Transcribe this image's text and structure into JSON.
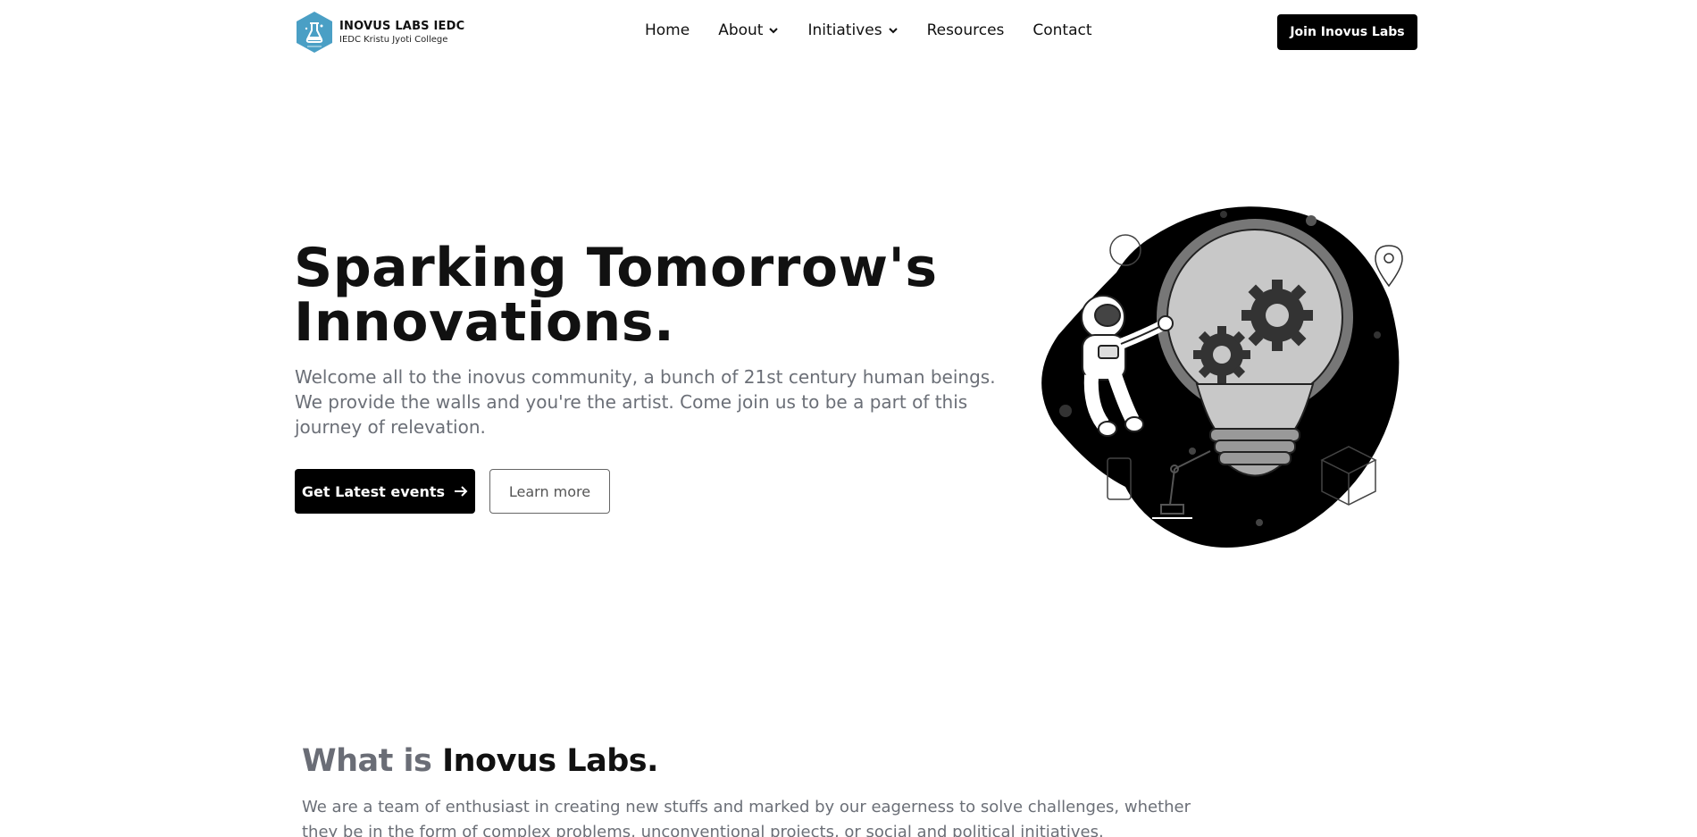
{
  "header": {
    "brand_name": "INOVUS LABS IEDC",
    "brand_sub": "IEDC Kristu Jyoti College",
    "logo_color": "#4a9fc5",
    "nav": [
      {
        "label": "Home",
        "has_dropdown": false
      },
      {
        "label": "About",
        "has_dropdown": true
      },
      {
        "label": "Initiatives",
        "has_dropdown": true
      },
      {
        "label": "Resources",
        "has_dropdown": false
      },
      {
        "label": "Contact",
        "has_dropdown": false
      }
    ],
    "cta_label": "Join Inovus Labs"
  },
  "hero": {
    "title_line1": "Sparking Tomorrow's",
    "title_line2": "Innovations.",
    "description": "Welcome all to the inovus community, a bunch of 21st century human beings. We provide the walls and you're the artist. Come join us to be a part of this journey of relevation.",
    "primary_button": "Get Latest events",
    "primary_icon": "arrow-right-icon",
    "secondary_button": "Learn more",
    "illustration": "astronaut-lightbulb-gears-illustration"
  },
  "about": {
    "title_prefix": "What is",
    "title_emphasis": "Inovus Labs.",
    "description": "We are a team of enthusiast in creating new stuffs and marked by our eagerness to solve challenges, whether they be in the form of complex problems, unconventional projects, or social and political initiatives."
  }
}
